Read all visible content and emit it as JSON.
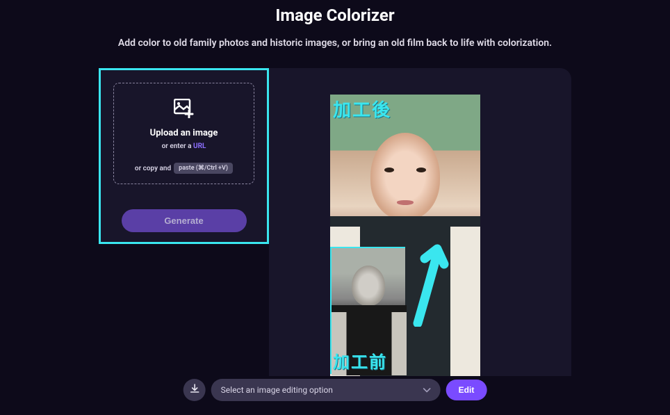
{
  "header": {
    "title": "Image Colorizer",
    "subtitle": "Add color to old family photos and historic images, or bring an old film back to life with colorization."
  },
  "upload": {
    "title": "Upload an image",
    "or_enter": "or enter a",
    "url_label": "URL",
    "copy_and": "or copy and",
    "paste_label": "paste (⌘/Ctrl +V)"
  },
  "generate_label": "Generate",
  "preview": {
    "label_after": "加工後",
    "label_before": "加工前"
  },
  "bottom": {
    "select_placeholder": "Select an image editing option",
    "edit_label": "Edit"
  },
  "colors": {
    "accent_cyan": "#3ae6ef",
    "accent_purple": "#7a4bff",
    "bg_dark": "#0d0a1a",
    "panel_bg": "#18152a"
  }
}
